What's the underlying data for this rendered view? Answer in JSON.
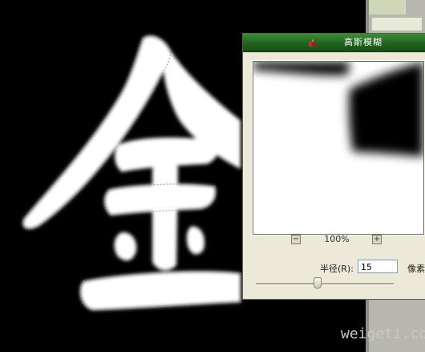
{
  "dialog": {
    "title": "高斯模糊",
    "zoom_label": "100%",
    "zoom_out": "−",
    "zoom_in": "+",
    "radius_label": "半径(R):",
    "radius_value": "15",
    "radius_unit": "像素",
    "slider_level": 0.45
  },
  "canvas": {
    "glyph": "金"
  },
  "watermark": "weigeti.com",
  "icons": {
    "title_icon": "brush-app-icon",
    "zoom_out": "minus-icon",
    "zoom_in": "plus-icon"
  }
}
